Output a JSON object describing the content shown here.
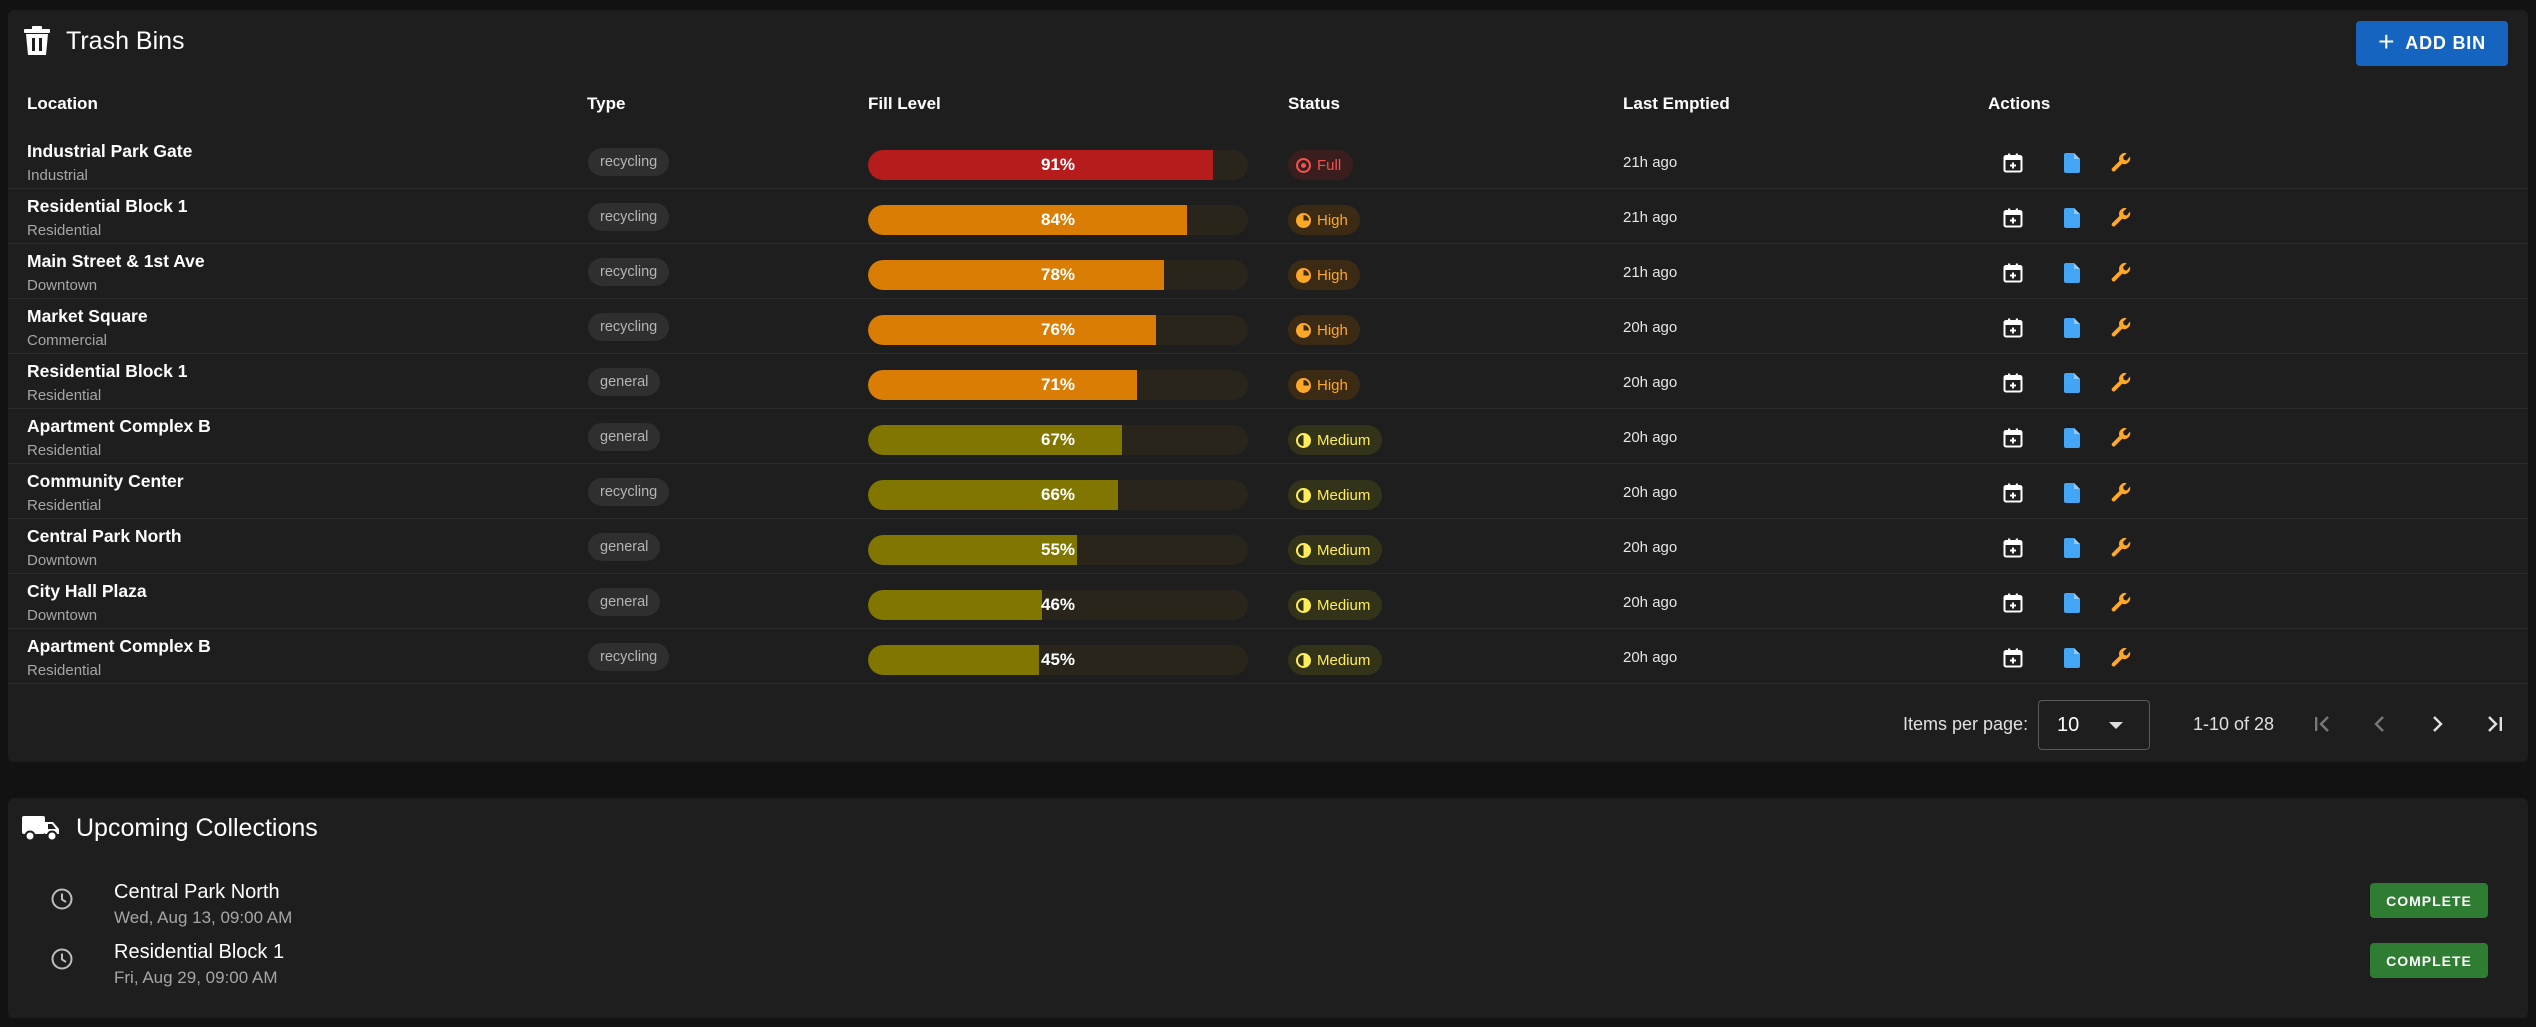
{
  "bins": {
    "title": "Trash Bins",
    "title_icon": "trash-icon",
    "add_button": {
      "label": "ADD BIN",
      "icon": "plus-icon"
    },
    "columns": [
      "Location",
      "Type",
      "Fill Level",
      "Status",
      "Last Emptied",
      "Actions"
    ],
    "rows": [
      {
        "name": "Industrial Park Gate",
        "area": "Industrial",
        "type": "recycling",
        "fill": 91,
        "fill_label": "91%",
        "status": "Full",
        "status_level": "full",
        "emptied": "21h ago"
      },
      {
        "name": "Residential Block 1",
        "area": "Residential",
        "type": "recycling",
        "fill": 84,
        "fill_label": "84%",
        "status": "High",
        "status_level": "high",
        "emptied": "21h ago"
      },
      {
        "name": "Main Street & 1st Ave",
        "area": "Downtown",
        "type": "recycling",
        "fill": 78,
        "fill_label": "78%",
        "status": "High",
        "status_level": "high",
        "emptied": "21h ago"
      },
      {
        "name": "Market Square",
        "area": "Commercial",
        "type": "recycling",
        "fill": 76,
        "fill_label": "76%",
        "status": "High",
        "status_level": "high",
        "emptied": "20h ago"
      },
      {
        "name": "Residential Block 1",
        "area": "Residential",
        "type": "general",
        "fill": 71,
        "fill_label": "71%",
        "status": "High",
        "status_level": "high",
        "emptied": "20h ago"
      },
      {
        "name": "Apartment Complex B",
        "area": "Residential",
        "type": "general",
        "fill": 67,
        "fill_label": "67%",
        "status": "Medium",
        "status_level": "medium",
        "emptied": "20h ago"
      },
      {
        "name": "Community Center",
        "area": "Residential",
        "type": "recycling",
        "fill": 66,
        "fill_label": "66%",
        "status": "Medium",
        "status_level": "medium",
        "emptied": "20h ago"
      },
      {
        "name": "Central Park North",
        "area": "Downtown",
        "type": "general",
        "fill": 55,
        "fill_label": "55%",
        "status": "Medium",
        "status_level": "medium",
        "emptied": "20h ago"
      },
      {
        "name": "City Hall Plaza",
        "area": "Downtown",
        "type": "general",
        "fill": 46,
        "fill_label": "46%",
        "status": "Medium",
        "status_level": "medium",
        "emptied": "20h ago"
      },
      {
        "name": "Apartment Complex B",
        "area": "Residential",
        "type": "recycling",
        "fill": 45,
        "fill_label": "45%",
        "status": "Medium",
        "status_level": "medium",
        "emptied": "20h ago"
      }
    ],
    "action_icons": [
      "calendar-add-icon",
      "document-icon",
      "wrench-icon"
    ],
    "pagination": {
      "items_per_page_label": "Items per page:",
      "items_per_page_value": "10",
      "range": "1-10 of 28"
    }
  },
  "collections": {
    "title": "Upcoming Collections",
    "title_icon": "truck-icon",
    "items": [
      {
        "name": "Central Park North",
        "date": "Wed, Aug 13, 09:00 AM",
        "button": "COMPLETE"
      },
      {
        "name": "Residential Block 1",
        "date": "Fri, Aug 29, 09:00 AM",
        "button": "COMPLETE"
      }
    ]
  },
  "colors": {
    "background": "#121212",
    "card": "#1e1e1e",
    "primary": "#1565c0",
    "full": "#b71c1c",
    "high": "#d97d05",
    "medium": "#807600",
    "success": "#2e7d32",
    "doc_icon": "#42a5f5",
    "wrench_icon": "#ffa726"
  }
}
